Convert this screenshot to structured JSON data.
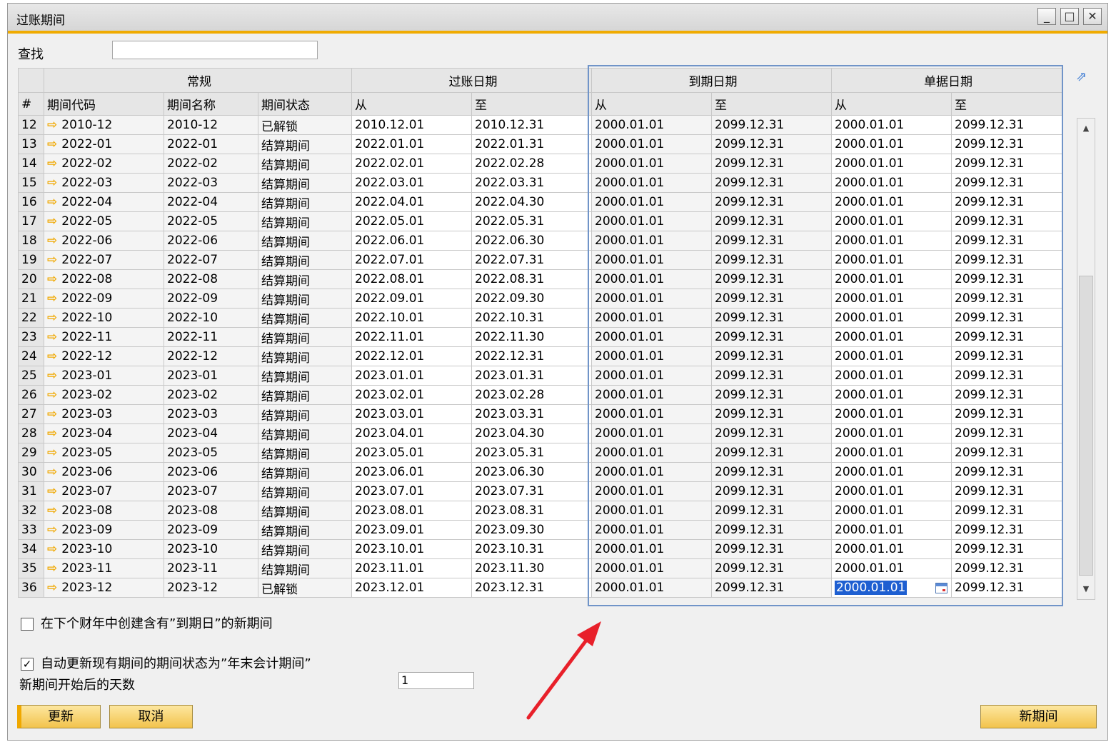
{
  "window": {
    "title": "过账期间"
  },
  "search": {
    "label": "查找",
    "value": ""
  },
  "table": {
    "group_headers": [
      "常规",
      "过账日期",
      "到期日期",
      "单据日期"
    ],
    "row_num_header": "#",
    "sub_headers": [
      "期间代码",
      "期间名称",
      "期间状态",
      "从",
      "至",
      "从",
      "至",
      "从",
      "至"
    ],
    "rows": [
      {
        "num": "12",
        "code": "2010-12",
        "name": "2010-12",
        "status": "已解锁",
        "post_from": "2010.12.01",
        "post_to": "2010.12.31",
        "due_from": "2000.01.01",
        "due_to": "2099.12.31",
        "doc_from": "2000.01.01",
        "doc_to": "2099.12.31"
      },
      {
        "num": "13",
        "code": "2022-01",
        "name": "2022-01",
        "status": "结算期间",
        "post_from": "2022.01.01",
        "post_to": "2022.01.31",
        "due_from": "2000.01.01",
        "due_to": "2099.12.31",
        "doc_from": "2000.01.01",
        "doc_to": "2099.12.31"
      },
      {
        "num": "14",
        "code": "2022-02",
        "name": "2022-02",
        "status": "结算期间",
        "post_from": "2022.02.01",
        "post_to": "2022.02.28",
        "due_from": "2000.01.01",
        "due_to": "2099.12.31",
        "doc_from": "2000.01.01",
        "doc_to": "2099.12.31"
      },
      {
        "num": "15",
        "code": "2022-03",
        "name": "2022-03",
        "status": "结算期间",
        "post_from": "2022.03.01",
        "post_to": "2022.03.31",
        "due_from": "2000.01.01",
        "due_to": "2099.12.31",
        "doc_from": "2000.01.01",
        "doc_to": "2099.12.31"
      },
      {
        "num": "16",
        "code": "2022-04",
        "name": "2022-04",
        "status": "结算期间",
        "post_from": "2022.04.01",
        "post_to": "2022.04.30",
        "due_from": "2000.01.01",
        "due_to": "2099.12.31",
        "doc_from": "2000.01.01",
        "doc_to": "2099.12.31"
      },
      {
        "num": "17",
        "code": "2022-05",
        "name": "2022-05",
        "status": "结算期间",
        "post_from": "2022.05.01",
        "post_to": "2022.05.31",
        "due_from": "2000.01.01",
        "due_to": "2099.12.31",
        "doc_from": "2000.01.01",
        "doc_to": "2099.12.31"
      },
      {
        "num": "18",
        "code": "2022-06",
        "name": "2022-06",
        "status": "结算期间",
        "post_from": "2022.06.01",
        "post_to": "2022.06.30",
        "due_from": "2000.01.01",
        "due_to": "2099.12.31",
        "doc_from": "2000.01.01",
        "doc_to": "2099.12.31"
      },
      {
        "num": "19",
        "code": "2022-07",
        "name": "2022-07",
        "status": "结算期间",
        "post_from": "2022.07.01",
        "post_to": "2022.07.31",
        "due_from": "2000.01.01",
        "due_to": "2099.12.31",
        "doc_from": "2000.01.01",
        "doc_to": "2099.12.31"
      },
      {
        "num": "20",
        "code": "2022-08",
        "name": "2022-08",
        "status": "结算期间",
        "post_from": "2022.08.01",
        "post_to": "2022.08.31",
        "due_from": "2000.01.01",
        "due_to": "2099.12.31",
        "doc_from": "2000.01.01",
        "doc_to": "2099.12.31"
      },
      {
        "num": "21",
        "code": "2022-09",
        "name": "2022-09",
        "status": "结算期间",
        "post_from": "2022.09.01",
        "post_to": "2022.09.30",
        "due_from": "2000.01.01",
        "due_to": "2099.12.31",
        "doc_from": "2000.01.01",
        "doc_to": "2099.12.31"
      },
      {
        "num": "22",
        "code": "2022-10",
        "name": "2022-10",
        "status": "结算期间",
        "post_from": "2022.10.01",
        "post_to": "2022.10.31",
        "due_from": "2000.01.01",
        "due_to": "2099.12.31",
        "doc_from": "2000.01.01",
        "doc_to": "2099.12.31"
      },
      {
        "num": "23",
        "code": "2022-11",
        "name": "2022-11",
        "status": "结算期间",
        "post_from": "2022.11.01",
        "post_to": "2022.11.30",
        "due_from": "2000.01.01",
        "due_to": "2099.12.31",
        "doc_from": "2000.01.01",
        "doc_to": "2099.12.31"
      },
      {
        "num": "24",
        "code": "2022-12",
        "name": "2022-12",
        "status": "结算期间",
        "post_from": "2022.12.01",
        "post_to": "2022.12.31",
        "due_from": "2000.01.01",
        "due_to": "2099.12.31",
        "doc_from": "2000.01.01",
        "doc_to": "2099.12.31"
      },
      {
        "num": "25",
        "code": "2023-01",
        "name": "2023-01",
        "status": "结算期间",
        "post_from": "2023.01.01",
        "post_to": "2023.01.31",
        "due_from": "2000.01.01",
        "due_to": "2099.12.31",
        "doc_from": "2000.01.01",
        "doc_to": "2099.12.31"
      },
      {
        "num": "26",
        "code": "2023-02",
        "name": "2023-02",
        "status": "结算期间",
        "post_from": "2023.02.01",
        "post_to": "2023.02.28",
        "due_from": "2000.01.01",
        "due_to": "2099.12.31",
        "doc_from": "2000.01.01",
        "doc_to": "2099.12.31"
      },
      {
        "num": "27",
        "code": "2023-03",
        "name": "2023-03",
        "status": "结算期间",
        "post_from": "2023.03.01",
        "post_to": "2023.03.31",
        "due_from": "2000.01.01",
        "due_to": "2099.12.31",
        "doc_from": "2000.01.01",
        "doc_to": "2099.12.31"
      },
      {
        "num": "28",
        "code": "2023-04",
        "name": "2023-04",
        "status": "结算期间",
        "post_from": "2023.04.01",
        "post_to": "2023.04.30",
        "due_from": "2000.01.01",
        "due_to": "2099.12.31",
        "doc_from": "2000.01.01",
        "doc_to": "2099.12.31"
      },
      {
        "num": "29",
        "code": "2023-05",
        "name": "2023-05",
        "status": "结算期间",
        "post_from": "2023.05.01",
        "post_to": "2023.05.31",
        "due_from": "2000.01.01",
        "due_to": "2099.12.31",
        "doc_from": "2000.01.01",
        "doc_to": "2099.12.31"
      },
      {
        "num": "30",
        "code": "2023-06",
        "name": "2023-06",
        "status": "结算期间",
        "post_from": "2023.06.01",
        "post_to": "2023.06.30",
        "due_from": "2000.01.01",
        "due_to": "2099.12.31",
        "doc_from": "2000.01.01",
        "doc_to": "2099.12.31"
      },
      {
        "num": "31",
        "code": "2023-07",
        "name": "2023-07",
        "status": "结算期间",
        "post_from": "2023.07.01",
        "post_to": "2023.07.31",
        "due_from": "2000.01.01",
        "due_to": "2099.12.31",
        "doc_from": "2000.01.01",
        "doc_to": "2099.12.31"
      },
      {
        "num": "32",
        "code": "2023-08",
        "name": "2023-08",
        "status": "结算期间",
        "post_from": "2023.08.01",
        "post_to": "2023.08.31",
        "due_from": "2000.01.01",
        "due_to": "2099.12.31",
        "doc_from": "2000.01.01",
        "doc_to": "2099.12.31"
      },
      {
        "num": "33",
        "code": "2023-09",
        "name": "2023-09",
        "status": "结算期间",
        "post_from": "2023.09.01",
        "post_to": "2023.09.30",
        "due_from": "2000.01.01",
        "due_to": "2099.12.31",
        "doc_from": "2000.01.01",
        "doc_to": "2099.12.31"
      },
      {
        "num": "34",
        "code": "2023-10",
        "name": "2023-10",
        "status": "结算期间",
        "post_from": "2023.10.01",
        "post_to": "2023.10.31",
        "due_from": "2000.01.01",
        "due_to": "2099.12.31",
        "doc_from": "2000.01.01",
        "doc_to": "2099.12.31"
      },
      {
        "num": "35",
        "code": "2023-11",
        "name": "2023-11",
        "status": "结算期间",
        "post_from": "2023.11.01",
        "post_to": "2023.11.30",
        "due_from": "2000.01.01",
        "due_to": "2099.12.31",
        "doc_from": "2000.01.01",
        "doc_to": "2099.12.31"
      },
      {
        "num": "36",
        "code": "2023-12",
        "name": "2023-12",
        "status": "已解锁",
        "post_from": "2023.12.01",
        "post_to": "2023.12.31",
        "due_from": "2000.01.01",
        "due_to": "2099.12.31",
        "doc_from": "2000.01.01",
        "doc_to": "2099.12.31"
      }
    ],
    "selected_row": "36",
    "selected_column": "doc_from"
  },
  "options": {
    "create_new_period_label": "在下个财年中创建含有”到期日”的新期间",
    "create_new_period_checked": false,
    "auto_update_label": "自动更新现有期间的期间状态为”年末会计期间”",
    "auto_update_checked": true,
    "days_label": "新期间开始后的天数",
    "days_value": "1"
  },
  "buttons": {
    "update": "更新",
    "cancel": "取消",
    "new_period": "新期间"
  },
  "colors": {
    "accent": "#f0ab00",
    "highlight_box": "#7094c8",
    "annotation_arrow": "#e8202a",
    "selection": "#1e5fd1"
  },
  "icons": {
    "row_link": "orange-arrow-icon",
    "date_picker": "calendar-icon",
    "expand": "expand-arrow-icon"
  }
}
